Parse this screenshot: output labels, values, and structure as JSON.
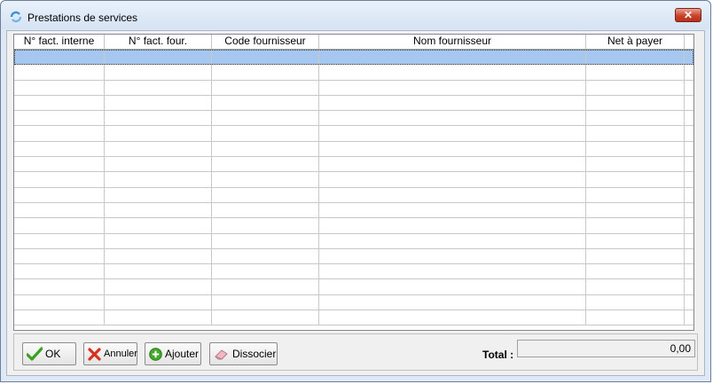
{
  "window": {
    "title": "Prestations de services",
    "close_symbol": "✕"
  },
  "grid": {
    "columns": [
      "N° fact. interne",
      "N° fact. four.",
      "Code fournisseur",
      "Nom fournisseur",
      "Net à payer"
    ],
    "row_count": 18,
    "selected_row": 0
  },
  "buttons": {
    "ok": "OK",
    "annuler": "Annuler",
    "ajouter": "Ajouter",
    "dissocier": "Dissocier"
  },
  "total": {
    "label": "Total :",
    "value": "0,00"
  },
  "colors": {
    "selection": "#a6c8f0",
    "titlebar": "#dfe9f5"
  }
}
